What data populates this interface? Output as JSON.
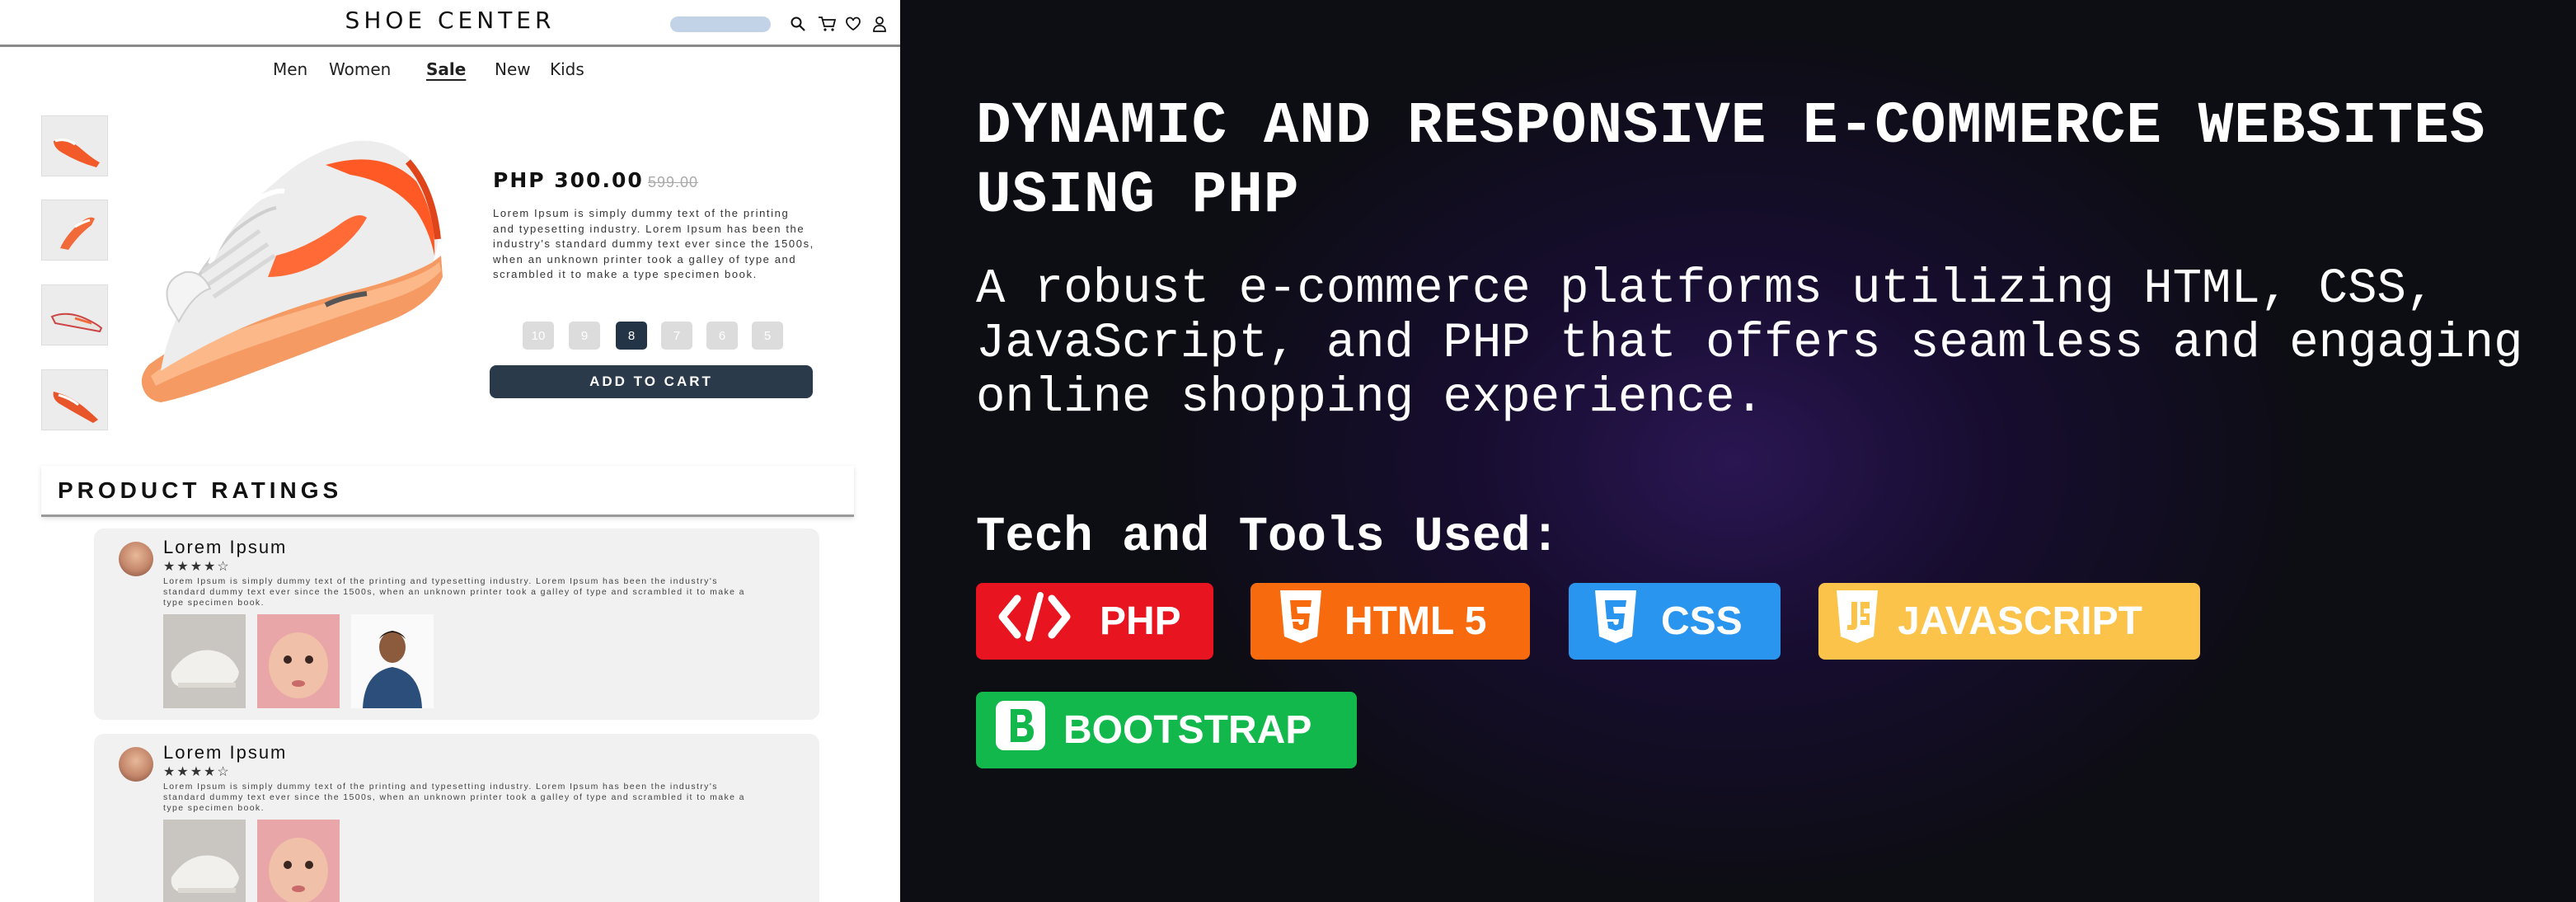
{
  "shop": {
    "brand": "SHOE CENTER",
    "nav": [
      "Men",
      "Women",
      "Sale",
      "New",
      "Kids"
    ],
    "active_nav": "Sale",
    "product": {
      "price": "PHP 300.00",
      "old_price": "599.00",
      "description": "Lorem Ipsum is simply dummy text of the printing and typesetting industry. Lorem Ipsum has been the industry's standard dummy text ever since the 1500s, when an unknown printer took a galley of type and scrambled it to make a type specimen book.",
      "sizes": [
        "10",
        "9",
        "8",
        "7",
        "6",
        "5"
      ],
      "selected_size": "8",
      "add_to_cart": "ADD TO CART"
    },
    "ratings_title": "PRODUCT RATINGS",
    "reviews": [
      {
        "name": "Lorem Ipsum",
        "stars": "★★★★☆",
        "rating": 4,
        "text": "Lorem Ipsum is simply dummy text of the  printing and typesetting industry. Lorem Ipsum has been the industry's standard  dummy text ever since the 1500s, when an unknown printer took a galley of type  and scrambled it to make a type specimen  book."
      },
      {
        "name": "Lorem Ipsum",
        "stars": "★★★★☆",
        "rating": 4,
        "text": "Lorem Ipsum is simply dummy text of the  printing and typesetting industry. Lorem Ipsum has been the industry's standard  dummy text ever since the 1500s, when an unknown printer took a galley of type  and scrambled it to make a type specimen  book."
      }
    ]
  },
  "panel": {
    "title": "DYNAMIC AND RESPONSIVE E-COMMERCE WEBSITES USING PHP",
    "subtitle": "A robust e-commerce platforms utilizing HTML, CSS, JavaScript, and PHP that offers seamless and engaging online shopping experience.",
    "tools_heading": "Tech and Tools Used:",
    "badges": [
      {
        "label": "PHP",
        "icon": "code-icon",
        "color": "#e8141f"
      },
      {
        "label": "HTML 5",
        "icon": "html5-icon",
        "color": "#f76a0d"
      },
      {
        "label": "CSS",
        "icon": "css3-icon",
        "color": "#2a95ee"
      },
      {
        "label": "JAVASCRIPT",
        "icon": "js-icon",
        "color": "#fbc34a"
      },
      {
        "label": "BOOTSTRAP",
        "icon": "bootstrap-icon",
        "color": "#12b84c"
      }
    ]
  },
  "colors": {
    "panel_bg": "#0d0d14",
    "panel_glow": "#2a1652",
    "cart_button": "#2a3a4b",
    "selected_size": "#243447",
    "search_bar": "#c2d3e7"
  }
}
